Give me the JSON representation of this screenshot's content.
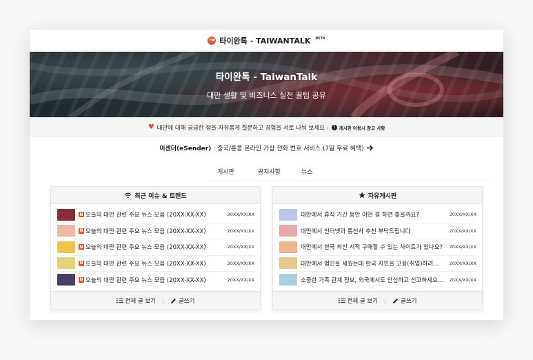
{
  "topbar": {
    "logo_text": "TW",
    "title": "타이완톡 - TAIWANTALK",
    "badge": "BETA"
  },
  "hero": {
    "title": "타이완톡 - TaiwanTalk",
    "subtitle": "대만 생활 및 비즈니스 실전 꿀팁 공유"
  },
  "notice": {
    "text": "대만에 대해 궁금한 점을 자유롭게 질문하고 경험을 서로 나눠 보세요 -",
    "link_label": "게시판 이용시 참고 사항"
  },
  "promo": {
    "brand": "이센더(eSender)",
    "text": ": 중국/홍콩 온라인 가상 전화 번호 서비스 (7일 무료 혜택)"
  },
  "tabs": [
    {
      "label": "게시판"
    },
    {
      "label": "공지사항"
    },
    {
      "label": "뉴스"
    }
  ],
  "left_board": {
    "title": "최근 이슈 & 트렌드",
    "badge": "N",
    "rows": [
      {
        "title": "오늘의 대만 관련 주요 뉴스 모음 (20XX-XX-XX)",
        "date": "20XX/XX/XX",
        "thumb_color": "#8a2b3a"
      },
      {
        "title": "오늘의 대만 관련 주요 뉴스 모음 (20XX-XX-XX)",
        "date": "20XX/XX/XX",
        "thumb_color": "#f0b7a6"
      },
      {
        "title": "오늘의 대만 관련 주요 뉴스 모음 (20XX-XX-XX)",
        "date": "20XX/XX/XX",
        "thumb_color": "#f2c14e"
      },
      {
        "title": "오늘의 대만 관련 주요 뉴스 모음 (20XX-XX-XX)",
        "date": "20XX/XX/XX",
        "thumb_color": "#e3d27a"
      },
      {
        "title": "오늘의 대만 관련 주요 뉴스 모음 (20XX-XX-XX)",
        "date": "20XX/XX/XX",
        "thumb_color": "#4a3d6b"
      }
    ],
    "view_all_label": "전체 글 보기",
    "write_label": "글쓰기"
  },
  "right_board": {
    "title": "자유게시판",
    "rows": [
      {
        "title": "대만에서 휴직 기간 동안 어떤 걸 하면 좋을까요?",
        "date": "20XX/XX/XX",
        "thumb_color": "#b9c6e6"
      },
      {
        "title": "대만에서 인터넷과 통신사 추천 부탁드립니다",
        "date": "20XX/XX/XX",
        "thumb_color": "#e6a9a9"
      },
      {
        "title": "대만에서 한국 최신 서적 구매할 수 있는 사이트가 있나요?",
        "date": "20XX/XX/XX",
        "thumb_color": "#f0b48c"
      },
      {
        "title": "대만에서 법인을 세웠는데 한국 지인을 고용(취업)하려…",
        "date": "20XX/XX/XX",
        "thumb_color": "#e6c98a"
      },
      {
        "title": "소중한 가족 관계 정보, 외국에서도 안심하고 신고하세요…",
        "date": "20XX/XX/XX",
        "thumb_color": "#a9cfe0"
      }
    ],
    "view_all_label": "전체 글 보기",
    "write_label": "글쓰기"
  },
  "colors": {
    "accent": "#e0542b"
  }
}
